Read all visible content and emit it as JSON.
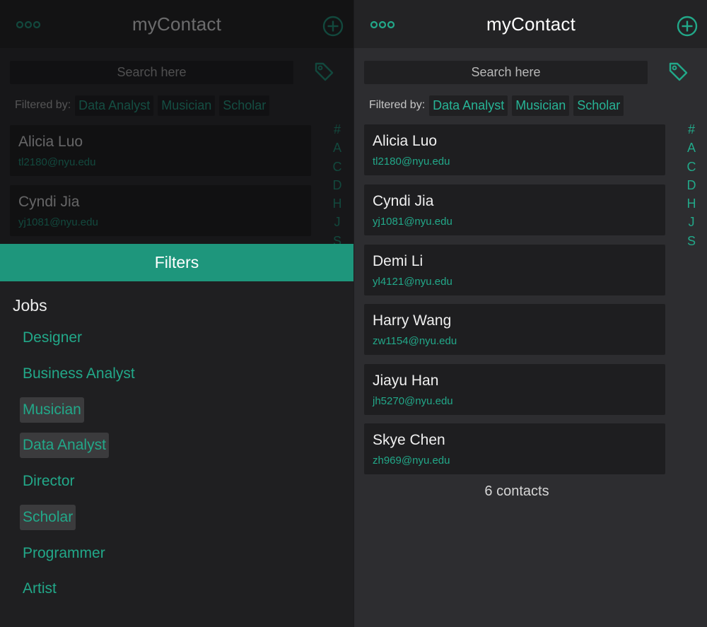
{
  "app": {
    "title": "myContact",
    "search_placeholder": "Search here",
    "filter_label": "Filtered by:",
    "active_filters": [
      "Data Analyst",
      "Musician",
      "Scholar"
    ],
    "alphabet_index": [
      "#",
      "A",
      "C",
      "D",
      "H",
      "J",
      "S"
    ],
    "icons": {
      "menu": "ellipsis-icon",
      "add": "plus-circle-icon",
      "tag": "tag-icon"
    },
    "colors": {
      "accent": "#22a889",
      "sheet_header": "#1e967c",
      "background": "#2d2d30",
      "card": "#1e1e20"
    }
  },
  "contacts": [
    {
      "name": "Alicia Luo",
      "email": "tl2180@nyu.edu"
    },
    {
      "name": "Cyndi Jia",
      "email": "yj1081@nyu.edu"
    },
    {
      "name": "Demi Li",
      "email": "yl4121@nyu.edu"
    },
    {
      "name": "Harry Wang",
      "email": "zw1154@nyu.edu"
    },
    {
      "name": "Jiayu Han",
      "email": "jh5270@nyu.edu"
    },
    {
      "name": "Skye Chen",
      "email": "zh969@nyu.edu"
    }
  ],
  "contact_count": "6 contacts",
  "filters_sheet": {
    "title": "Filters",
    "section_title": "Jobs",
    "jobs": [
      {
        "label": "Designer",
        "selected": false
      },
      {
        "label": "Business Analyst",
        "selected": false
      },
      {
        "label": "Musician",
        "selected": true
      },
      {
        "label": "Data Analyst",
        "selected": true
      },
      {
        "label": "Director",
        "selected": false
      },
      {
        "label": "Scholar",
        "selected": true
      },
      {
        "label": "Programmer",
        "selected": false
      },
      {
        "label": "Artist",
        "selected": false
      }
    ]
  }
}
